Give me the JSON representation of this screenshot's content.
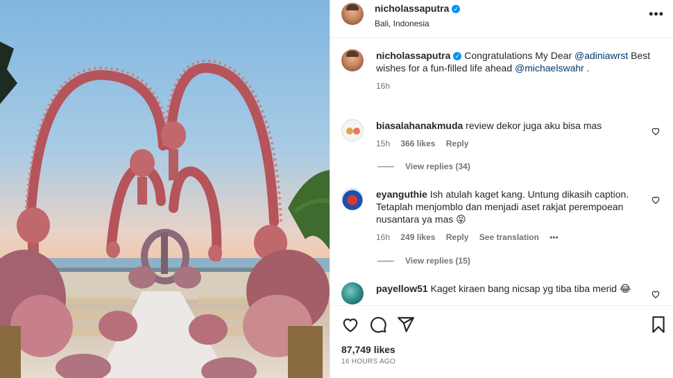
{
  "post": {
    "owner": {
      "username": "nicholassaputra",
      "location": "Bali, Indonesia"
    },
    "caption": {
      "username": "nicholassaputra",
      "text_before": "Congratulations My Dear ",
      "mention1": "@adiniawrst",
      "text_middle": " Best wishes for a fun-filled life ahead ",
      "mention2": "@michaelswahr",
      "text_after": " .",
      "time": "16h"
    },
    "photo_icon": "wedding-arch-photo"
  },
  "comments": [
    {
      "username": "biasalahanakmuda",
      "text": "review dekor juga aku bisa mas",
      "time": "15h",
      "likes": "366 likes",
      "reply": "Reply",
      "view_replies": "View replies (34)"
    },
    {
      "username": "eyanguthie",
      "text": "Ish atulah kaget kang. Untung dikasih caption. Tetaplah menjomblo dan menjadi aset rakjat perempoean nusantara ya mas 😝",
      "time": "16h",
      "likes": "249 likes",
      "reply": "Reply",
      "translation": "See translation",
      "more": "•••",
      "view_replies": "View replies (15)"
    },
    {
      "username": "payellow51",
      "text": "Kaget kiraen bang nicsap yg tiba tiba merid 😂"
    }
  ],
  "footer": {
    "likes": "87,749 likes",
    "time": "16 HOURS AGO"
  },
  "icons": {
    "more": "•••",
    "verified": "✓"
  }
}
